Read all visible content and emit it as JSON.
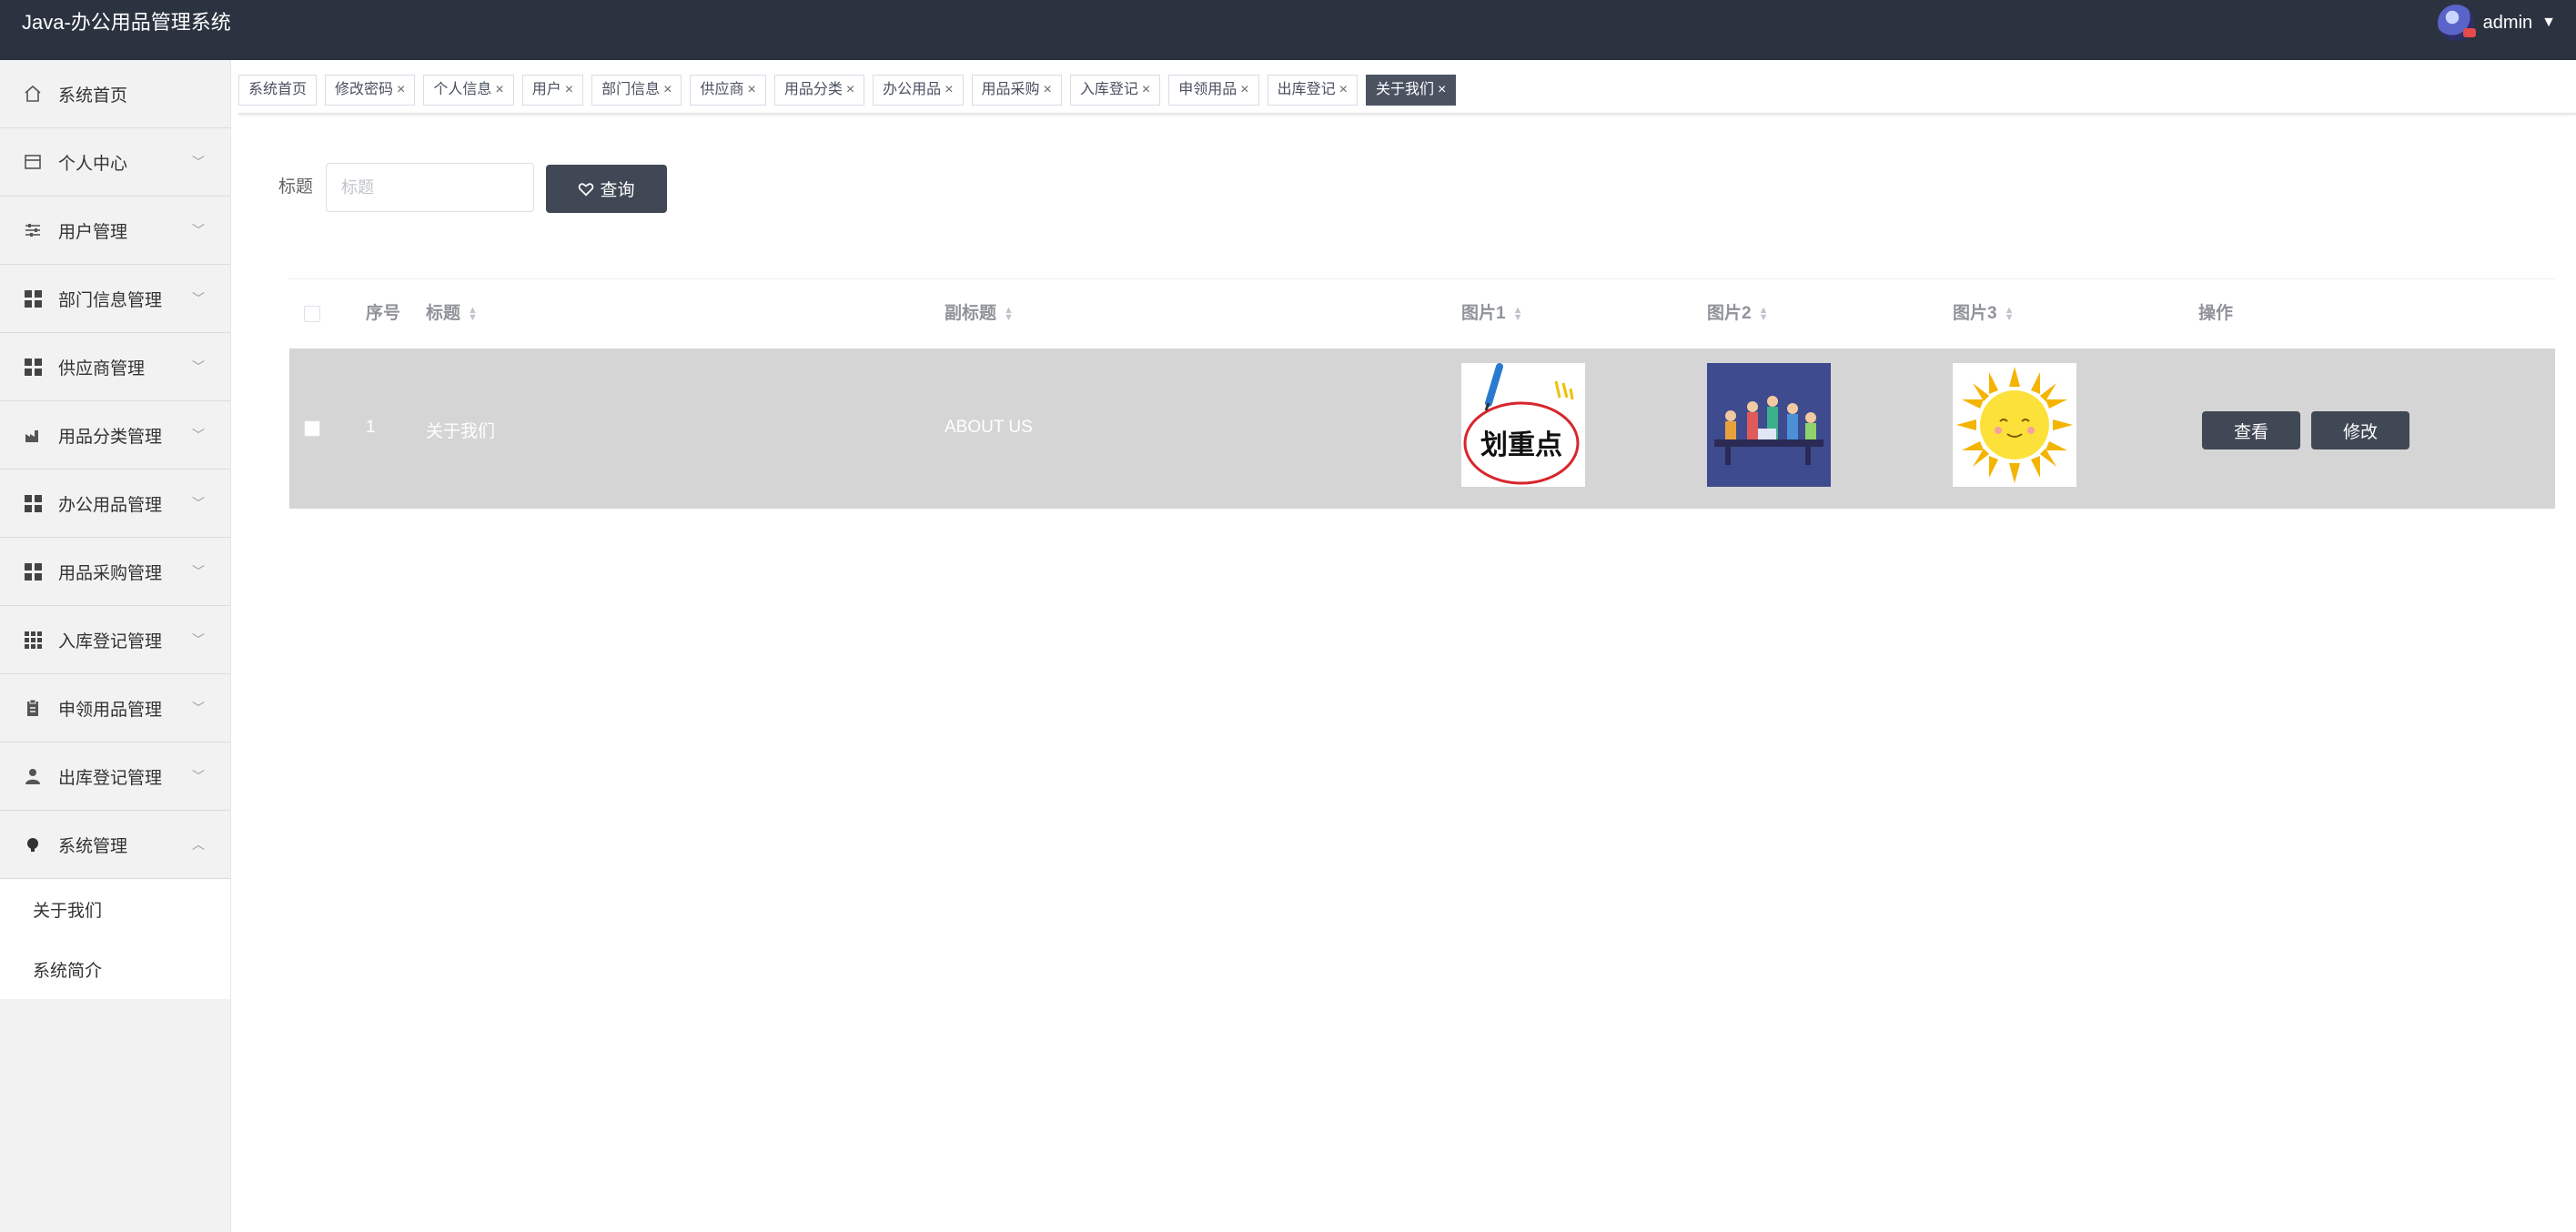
{
  "header": {
    "title": "Java-办公用品管理系统",
    "username": "admin"
  },
  "sidebar": {
    "items": [
      {
        "label": "系统首页",
        "icon": "home-icon",
        "expandable": false
      },
      {
        "label": "个人中心",
        "icon": "calendar-icon",
        "expandable": true
      },
      {
        "label": "用户管理",
        "icon": "sliders-icon",
        "expandable": true
      },
      {
        "label": "部门信息管理",
        "icon": "grid-icon",
        "expandable": true
      },
      {
        "label": "供应商管理",
        "icon": "grid-icon",
        "expandable": true
      },
      {
        "label": "用品分类管理",
        "icon": "factory-icon",
        "expandable": true
      },
      {
        "label": "办公用品管理",
        "icon": "grid-icon",
        "expandable": true
      },
      {
        "label": "用品采购管理",
        "icon": "grid-icon",
        "expandable": true
      },
      {
        "label": "入库登记管理",
        "icon": "grid9-icon",
        "expandable": true
      },
      {
        "label": "申领用品管理",
        "icon": "clipboard-icon",
        "expandable": true
      },
      {
        "label": "出库登记管理",
        "icon": "user-icon",
        "expandable": true
      },
      {
        "label": "系统管理",
        "icon": "bulb-icon",
        "expandable": true,
        "expanded": true
      }
    ],
    "submenu": [
      "关于我们",
      "系统简介"
    ]
  },
  "tabs": [
    {
      "label": "系统首页",
      "closable": false
    },
    {
      "label": "修改密码",
      "closable": true
    },
    {
      "label": "个人信息",
      "closable": true
    },
    {
      "label": "用户",
      "closable": true
    },
    {
      "label": "部门信息",
      "closable": true
    },
    {
      "label": "供应商",
      "closable": true
    },
    {
      "label": "用品分类",
      "closable": true
    },
    {
      "label": "办公用品",
      "closable": true
    },
    {
      "label": "用品采购",
      "closable": true
    },
    {
      "label": "入库登记",
      "closable": true
    },
    {
      "label": "申领用品",
      "closable": true
    },
    {
      "label": "出库登记",
      "closable": true
    },
    {
      "label": "关于我们",
      "closable": true,
      "active": true
    }
  ],
  "search": {
    "label": "标题",
    "placeholder": "标题",
    "button": "查询"
  },
  "table": {
    "columns": [
      "序号",
      "标题",
      "副标题",
      "图片1",
      "图片2",
      "图片3",
      "操作"
    ],
    "rows": [
      {
        "index": "1",
        "title": "关于我们",
        "subtitle": "ABOUT US",
        "image1_text": "划重点",
        "view_label": "查看",
        "edit_label": "修改"
      }
    ]
  },
  "colors": {
    "topbar": "#2b3340",
    "button": "#404855",
    "active_tab": "#4b5361",
    "selected_row": "#d5d5d5"
  }
}
